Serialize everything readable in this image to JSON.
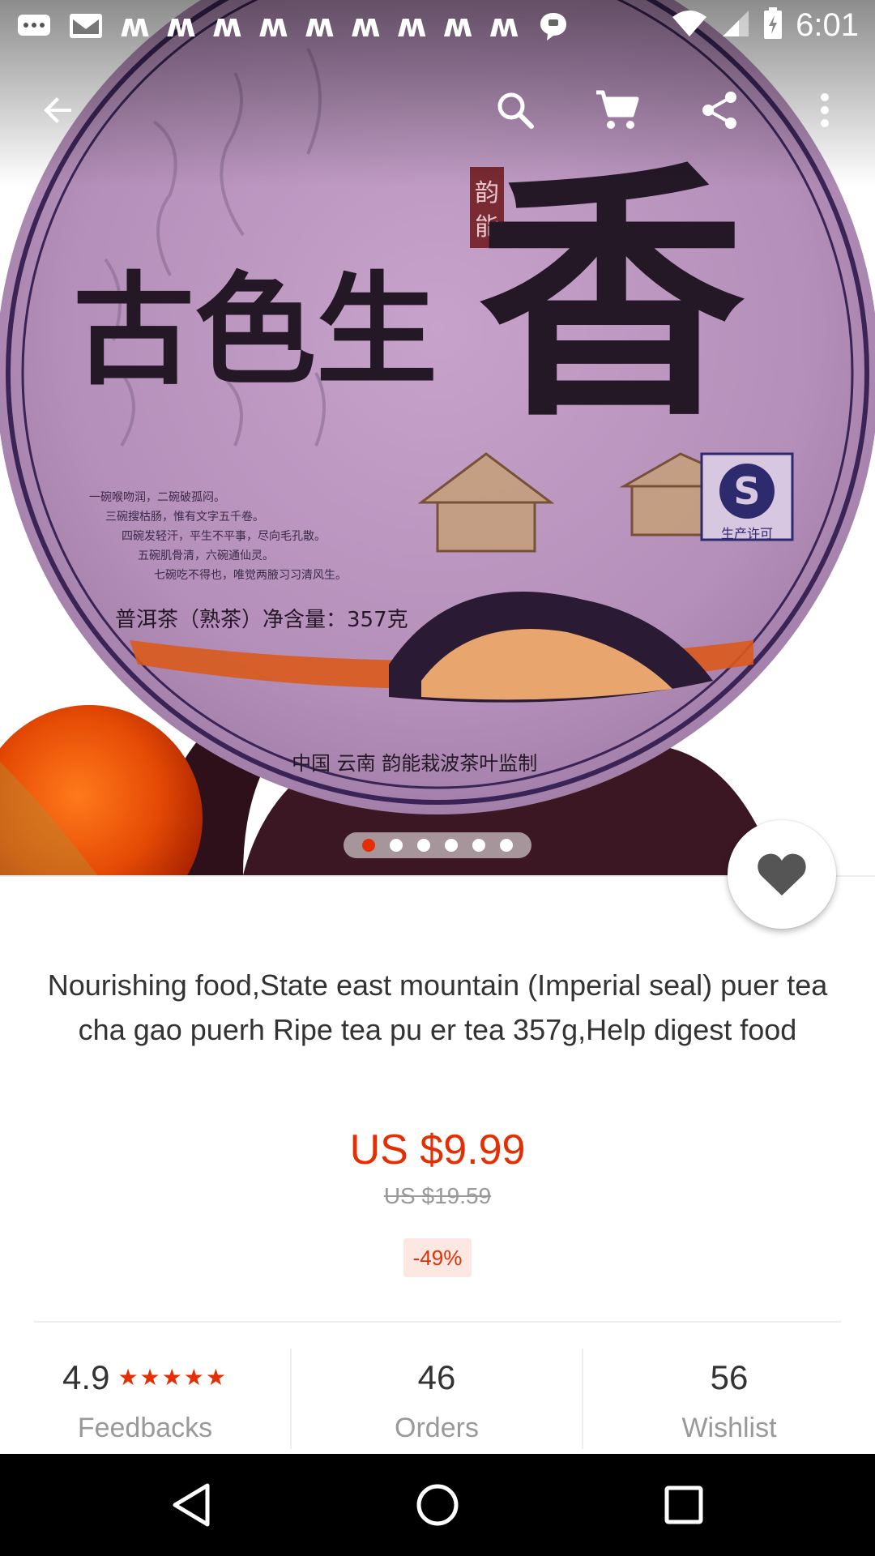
{
  "status_bar": {
    "time": "6:01",
    "notification_icons": [
      "chat-bubble-icon",
      "gmail-icon",
      "w",
      "w",
      "w",
      "w",
      "w",
      "w",
      "w",
      "w",
      "w",
      "message-bubble-icon"
    ],
    "right_icons": [
      "wifi-icon",
      "signal-icon",
      "battery-icon"
    ]
  },
  "toolbar": {
    "icons": [
      "back-arrow-icon",
      "search-icon",
      "cart-icon",
      "share-icon",
      "more-vert-icon"
    ]
  },
  "hero": {
    "image_text": {
      "big_characters": "古色生香",
      "seal": "韵能",
      "product_line": "普洱茶（熟茶）净含量：357克",
      "bottom_line": "中国 云南  韵能栽波茶叶监制",
      "qs_label": "生产许可"
    },
    "pager": {
      "count": 6,
      "active_index": 0
    }
  },
  "product": {
    "title": "Nourishing food,State east mountain (Imperial seal)  puer tea cha gao puerh Ripe tea pu er tea 357g,Help digest food",
    "price": "US $9.99",
    "original_price": "US $19.59",
    "discount": "-49%"
  },
  "stats": {
    "rating": "4.9",
    "stars": "★★★★★",
    "feedbacks_label": "Feedbacks",
    "orders_value": "46",
    "orders_label": "Orders",
    "wishlist_value": "56",
    "wishlist_label": "Wishlist"
  },
  "colors": {
    "accent": "#e62e04",
    "discount_bg": "#fde7e3",
    "text_primary": "#333333",
    "text_secondary": "#999999"
  },
  "nav_bar": {
    "icons": [
      "back-triangle-icon",
      "home-circle-icon",
      "recents-square-icon"
    ]
  }
}
